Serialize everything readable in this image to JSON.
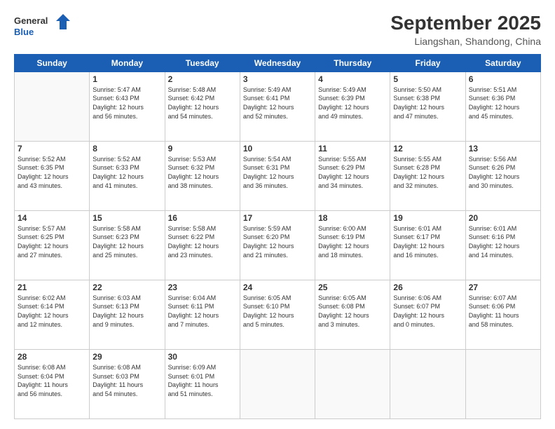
{
  "logo": {
    "line1": "General",
    "line2": "Blue"
  },
  "title": "September 2025",
  "location": "Liangshan, Shandong, China",
  "weekdays": [
    "Sunday",
    "Monday",
    "Tuesday",
    "Wednesday",
    "Thursday",
    "Friday",
    "Saturday"
  ],
  "weeks": [
    [
      {
        "day": "",
        "info": ""
      },
      {
        "day": "1",
        "info": "Sunrise: 5:47 AM\nSunset: 6:43 PM\nDaylight: 12 hours\nand 56 minutes."
      },
      {
        "day": "2",
        "info": "Sunrise: 5:48 AM\nSunset: 6:42 PM\nDaylight: 12 hours\nand 54 minutes."
      },
      {
        "day": "3",
        "info": "Sunrise: 5:49 AM\nSunset: 6:41 PM\nDaylight: 12 hours\nand 52 minutes."
      },
      {
        "day": "4",
        "info": "Sunrise: 5:49 AM\nSunset: 6:39 PM\nDaylight: 12 hours\nand 49 minutes."
      },
      {
        "day": "5",
        "info": "Sunrise: 5:50 AM\nSunset: 6:38 PM\nDaylight: 12 hours\nand 47 minutes."
      },
      {
        "day": "6",
        "info": "Sunrise: 5:51 AM\nSunset: 6:36 PM\nDaylight: 12 hours\nand 45 minutes."
      }
    ],
    [
      {
        "day": "7",
        "info": "Sunrise: 5:52 AM\nSunset: 6:35 PM\nDaylight: 12 hours\nand 43 minutes."
      },
      {
        "day": "8",
        "info": "Sunrise: 5:52 AM\nSunset: 6:33 PM\nDaylight: 12 hours\nand 41 minutes."
      },
      {
        "day": "9",
        "info": "Sunrise: 5:53 AM\nSunset: 6:32 PM\nDaylight: 12 hours\nand 38 minutes."
      },
      {
        "day": "10",
        "info": "Sunrise: 5:54 AM\nSunset: 6:31 PM\nDaylight: 12 hours\nand 36 minutes."
      },
      {
        "day": "11",
        "info": "Sunrise: 5:55 AM\nSunset: 6:29 PM\nDaylight: 12 hours\nand 34 minutes."
      },
      {
        "day": "12",
        "info": "Sunrise: 5:55 AM\nSunset: 6:28 PM\nDaylight: 12 hours\nand 32 minutes."
      },
      {
        "day": "13",
        "info": "Sunrise: 5:56 AM\nSunset: 6:26 PM\nDaylight: 12 hours\nand 30 minutes."
      }
    ],
    [
      {
        "day": "14",
        "info": "Sunrise: 5:57 AM\nSunset: 6:25 PM\nDaylight: 12 hours\nand 27 minutes."
      },
      {
        "day": "15",
        "info": "Sunrise: 5:58 AM\nSunset: 6:23 PM\nDaylight: 12 hours\nand 25 minutes."
      },
      {
        "day": "16",
        "info": "Sunrise: 5:58 AM\nSunset: 6:22 PM\nDaylight: 12 hours\nand 23 minutes."
      },
      {
        "day": "17",
        "info": "Sunrise: 5:59 AM\nSunset: 6:20 PM\nDaylight: 12 hours\nand 21 minutes."
      },
      {
        "day": "18",
        "info": "Sunrise: 6:00 AM\nSunset: 6:19 PM\nDaylight: 12 hours\nand 18 minutes."
      },
      {
        "day": "19",
        "info": "Sunrise: 6:01 AM\nSunset: 6:17 PM\nDaylight: 12 hours\nand 16 minutes."
      },
      {
        "day": "20",
        "info": "Sunrise: 6:01 AM\nSunset: 6:16 PM\nDaylight: 12 hours\nand 14 minutes."
      }
    ],
    [
      {
        "day": "21",
        "info": "Sunrise: 6:02 AM\nSunset: 6:14 PM\nDaylight: 12 hours\nand 12 minutes."
      },
      {
        "day": "22",
        "info": "Sunrise: 6:03 AM\nSunset: 6:13 PM\nDaylight: 12 hours\nand 9 minutes."
      },
      {
        "day": "23",
        "info": "Sunrise: 6:04 AM\nSunset: 6:11 PM\nDaylight: 12 hours\nand 7 minutes."
      },
      {
        "day": "24",
        "info": "Sunrise: 6:05 AM\nSunset: 6:10 PM\nDaylight: 12 hours\nand 5 minutes."
      },
      {
        "day": "25",
        "info": "Sunrise: 6:05 AM\nSunset: 6:08 PM\nDaylight: 12 hours\nand 3 minutes."
      },
      {
        "day": "26",
        "info": "Sunrise: 6:06 AM\nSunset: 6:07 PM\nDaylight: 12 hours\nand 0 minutes."
      },
      {
        "day": "27",
        "info": "Sunrise: 6:07 AM\nSunset: 6:06 PM\nDaylight: 11 hours\nand 58 minutes."
      }
    ],
    [
      {
        "day": "28",
        "info": "Sunrise: 6:08 AM\nSunset: 6:04 PM\nDaylight: 11 hours\nand 56 minutes."
      },
      {
        "day": "29",
        "info": "Sunrise: 6:08 AM\nSunset: 6:03 PM\nDaylight: 11 hours\nand 54 minutes."
      },
      {
        "day": "30",
        "info": "Sunrise: 6:09 AM\nSunset: 6:01 PM\nDaylight: 11 hours\nand 51 minutes."
      },
      {
        "day": "",
        "info": ""
      },
      {
        "day": "",
        "info": ""
      },
      {
        "day": "",
        "info": ""
      },
      {
        "day": "",
        "info": ""
      }
    ]
  ]
}
